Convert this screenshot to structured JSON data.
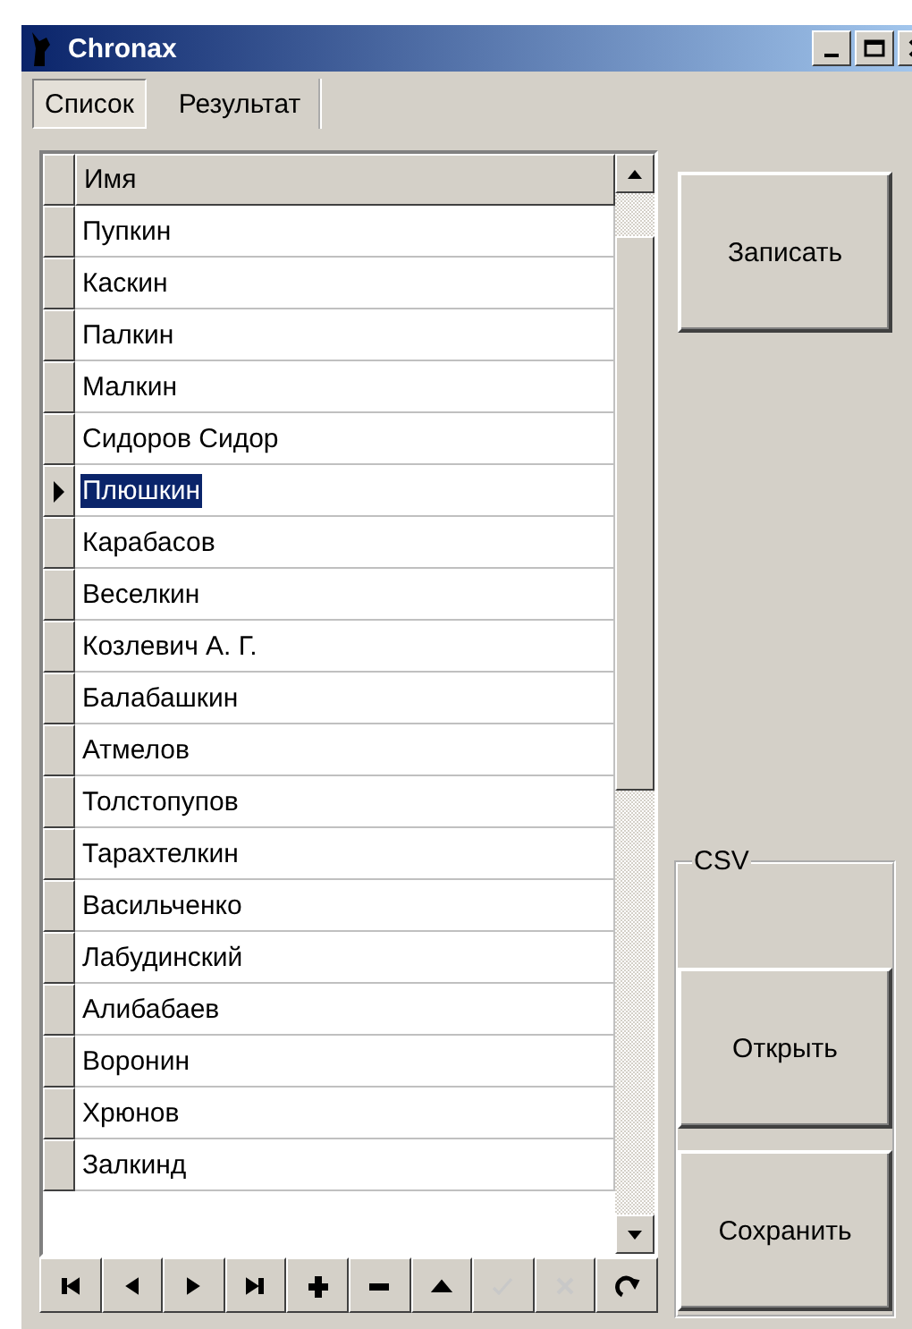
{
  "window": {
    "title": "Chronax"
  },
  "tabs": [
    {
      "label": "Список",
      "selected": true
    },
    {
      "label": "Результат",
      "selected": false
    }
  ],
  "grid": {
    "columns": [
      "Имя"
    ],
    "rows": [
      {
        "name": "Пупкин",
        "selected": false
      },
      {
        "name": "Каскин",
        "selected": false
      },
      {
        "name": "Палкин",
        "selected": false
      },
      {
        "name": "Малкин",
        "selected": false
      },
      {
        "name": "Сидоров Сидор",
        "selected": false
      },
      {
        "name": "Плюшкин",
        "selected": true
      },
      {
        "name": "Карабасов",
        "selected": false
      },
      {
        "name": "Веселкин",
        "selected": false
      },
      {
        "name": "Козлевич А. Г.",
        "selected": false
      },
      {
        "name": "Балабашкин",
        "selected": false
      },
      {
        "name": "Атмелов",
        "selected": false
      },
      {
        "name": "Толстопупов",
        "selected": false
      },
      {
        "name": "Тарахтелкин",
        "selected": false
      },
      {
        "name": "Васильченко",
        "selected": false
      },
      {
        "name": "Лабудинский",
        "selected": false
      },
      {
        "name": "Алибабаев",
        "selected": false
      },
      {
        "name": "Воронин",
        "selected": false
      },
      {
        "name": "Хрюнов",
        "selected": false
      },
      {
        "name": "Залкинд",
        "selected": false
      }
    ]
  },
  "navigator": [
    {
      "kind": "first",
      "disabled": false
    },
    {
      "kind": "prior",
      "disabled": false
    },
    {
      "kind": "next",
      "disabled": false
    },
    {
      "kind": "last",
      "disabled": false
    },
    {
      "kind": "insert",
      "disabled": false
    },
    {
      "kind": "delete",
      "disabled": false
    },
    {
      "kind": "edit",
      "disabled": false
    },
    {
      "kind": "post",
      "disabled": true
    },
    {
      "kind": "cancel",
      "disabled": true
    },
    {
      "kind": "refresh",
      "disabled": false
    }
  ],
  "write_button": "Записать",
  "csv_group": {
    "title": "CSV",
    "buttons": [
      "Открыть",
      "Сохранить"
    ]
  }
}
